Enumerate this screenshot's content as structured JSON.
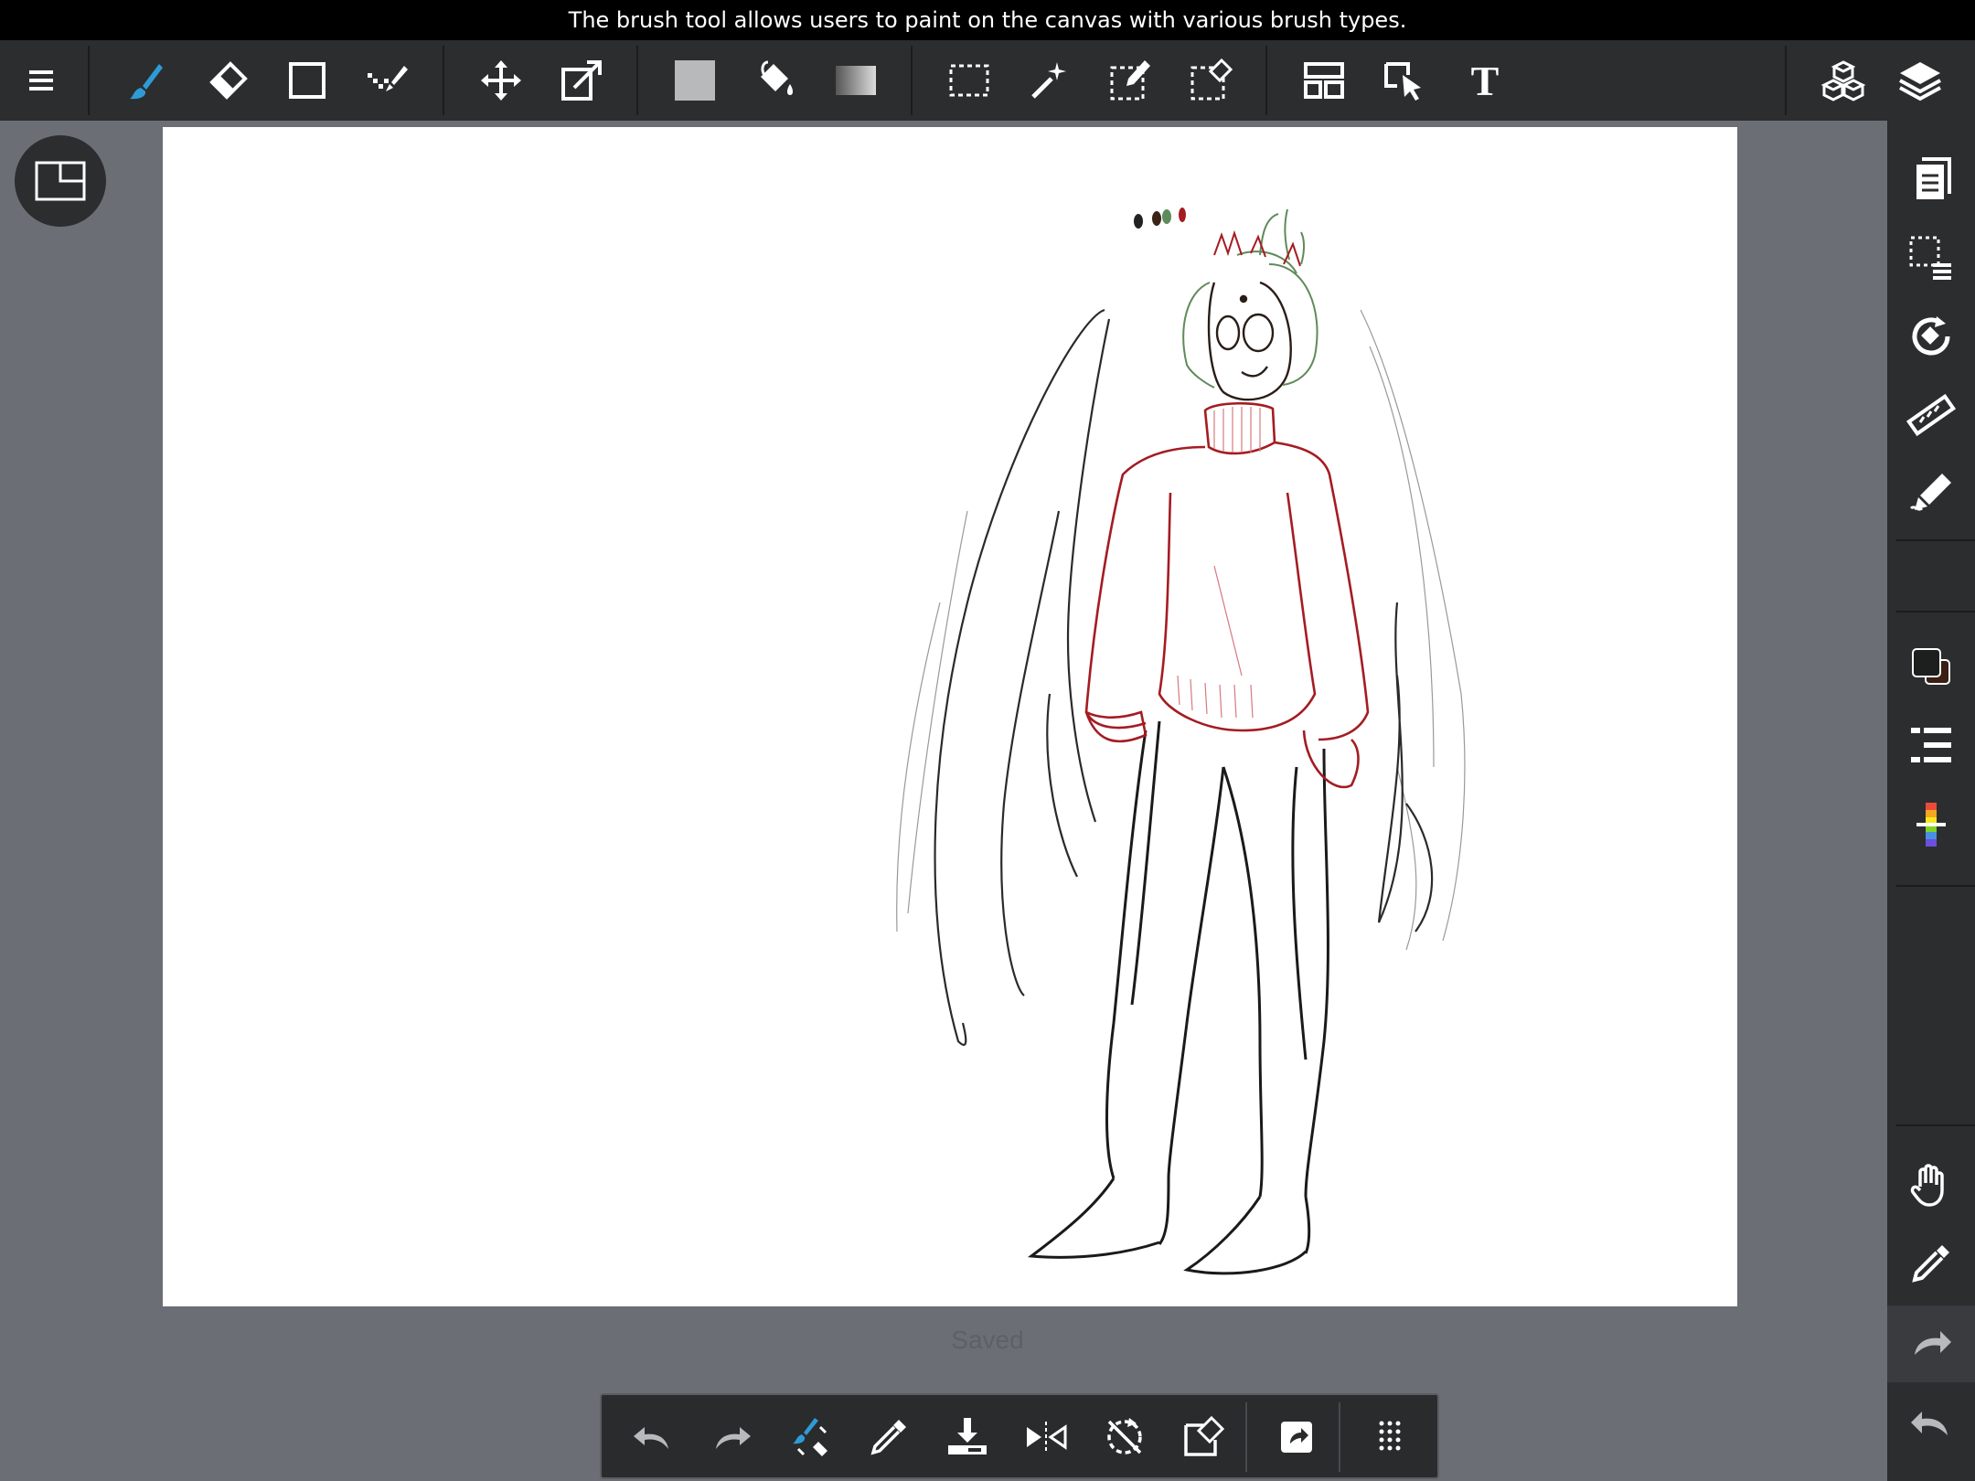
{
  "tooltip": {
    "text": "The brush tool allows users to paint on the canvas with various brush types."
  },
  "toolbar": {
    "tools": [
      {
        "name": "menu-icon"
      },
      {
        "name": "brush-icon",
        "active": true
      },
      {
        "name": "eraser-icon"
      },
      {
        "name": "shape-icon"
      },
      {
        "name": "dot-icon"
      },
      {
        "name": "move-icon"
      },
      {
        "name": "transform-icon"
      },
      {
        "name": "fill-color-icon"
      },
      {
        "name": "bucket-icon"
      },
      {
        "name": "gradient-icon"
      },
      {
        "name": "select-rect-icon"
      },
      {
        "name": "magic-wand-icon"
      },
      {
        "name": "select-pen-icon"
      },
      {
        "name": "select-eraser-icon"
      },
      {
        "name": "frame-divide-icon"
      },
      {
        "name": "operation-icon"
      },
      {
        "name": "text-icon"
      },
      {
        "name": "material-icon"
      },
      {
        "name": "layers-icon"
      }
    ],
    "text_tool_glyph": "T"
  },
  "sidebar": {
    "items": [
      "pages-icon",
      "selection-list-icon",
      "rotate-icon",
      "ruler-icon",
      "snap-pen-icon",
      "color-swatch-icon",
      "brush-list-icon",
      "color-palette-icon",
      "hand-icon",
      "eyedropper-icon",
      "redo-icon",
      "undo-icon"
    ]
  },
  "canvas": {
    "status": "Saved"
  },
  "quickbar": {
    "items": [
      "undo-icon",
      "redo-icon",
      "brush-eraser-toggle-icon",
      "eyedropper-icon",
      "save-icon",
      "flip-icon",
      "rotate-reset-icon",
      "clear-selection-icon",
      "share-icon",
      "more-icon"
    ]
  },
  "colors": {
    "accent": "#2e9bd6",
    "toolbar_bg": "#2c2d2f",
    "workspace_bg": "#6b6f75",
    "sweater_red": "#a41c22",
    "leaf_green": "#5f8a5a"
  }
}
